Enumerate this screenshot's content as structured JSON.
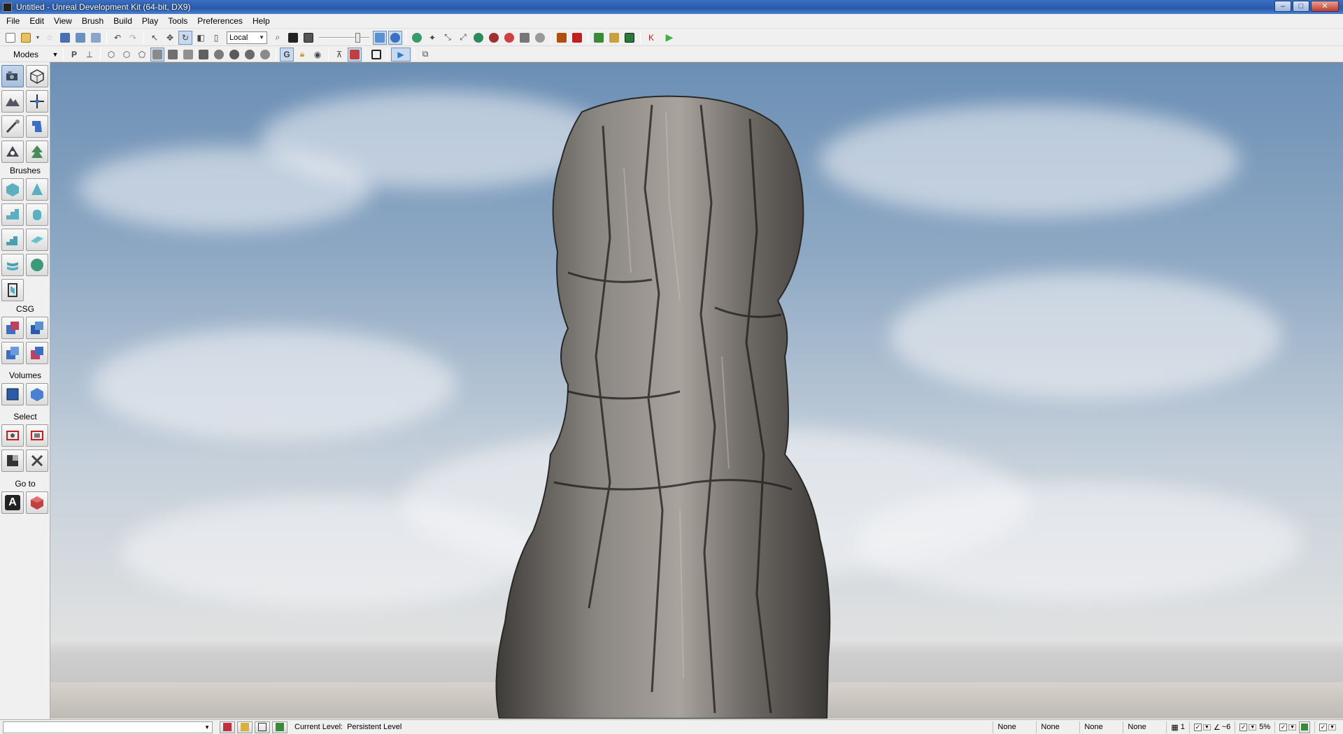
{
  "window": {
    "title": "Untitled - Unreal Development Kit (64-bit, DX9)",
    "minimize": "–",
    "maximize": "□",
    "close": "✕"
  },
  "menu": [
    "File",
    "Edit",
    "View",
    "Brush",
    "Build",
    "Play",
    "Tools",
    "Preferences",
    "Help"
  ],
  "toolbar": {
    "coordinate_system": "Local"
  },
  "toolbar2": {
    "modes_label": "Modes",
    "perspective_label": "P",
    "game_label": "G"
  },
  "modes_panel": {
    "brushes_label": "Brushes",
    "csg_label": "CSG",
    "volumes_label": "Volumes",
    "select_label": "Select",
    "goto_label": "Go to",
    "goto_actor_label": "A"
  },
  "status": {
    "current_level_label": "Current Level:",
    "current_level_value": "Persistent Level",
    "slots": [
      "None",
      "None",
      "None",
      "None"
    ],
    "drag_grid": "1",
    "rotation_grid": "~6",
    "scale_snap": "5%"
  },
  "colors": {
    "title_bar": "#2a5aa8",
    "sky_top": "#6b8fb5",
    "play_green": "#3cb043"
  }
}
